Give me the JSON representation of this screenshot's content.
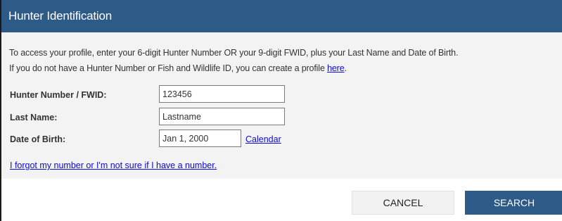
{
  "dialog": {
    "title": "Hunter Identification",
    "intro_line1": "To access your profile, enter your 6-digit Hunter Number OR your 9-digit FWID, plus your Last Name and Date of Birth.",
    "intro_line2_prefix": "If you do not have a Hunter Number or Fish and Wildlife ID, you can create a profile ",
    "intro_link": "here",
    "intro_line2_suffix": "."
  },
  "form": {
    "hunter_number_label": "Hunter Number / FWID:",
    "hunter_number_value": "123456",
    "last_name_label": "Last Name:",
    "last_name_value": "Lastname",
    "dob_label": "Date of Birth:",
    "dob_value": "Jan 1, 2000",
    "calendar_link": "Calendar",
    "forgot_link": "I forgot my number or I'm not sure if I have a number."
  },
  "buttons": {
    "cancel": "CANCEL",
    "search": "SEARCH"
  },
  "colors": {
    "header": "#2d5a86",
    "panel": "#f3f3f3",
    "link": "#0b0bd6"
  }
}
